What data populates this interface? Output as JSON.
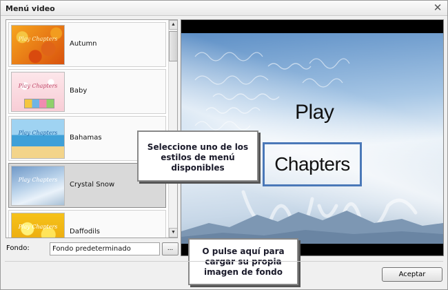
{
  "window": {
    "title": "Menú video"
  },
  "style_list": {
    "items": [
      {
        "label": "Autumn",
        "thumb_text": "Play Chapters"
      },
      {
        "label": "Baby",
        "thumb_text": "Play Chapters"
      },
      {
        "label": "Bahamas",
        "thumb_text": "Play Chapters"
      },
      {
        "label": "Crystal Snow",
        "thumb_text": "Play Chapters",
        "selected": true
      },
      {
        "label": "Daffodils",
        "thumb_text": "Play Chapters"
      }
    ]
  },
  "preview": {
    "menu_items": [
      "Play",
      "Chapters"
    ],
    "highlighted_item": "Chapters"
  },
  "callouts": {
    "style_hint": "Seleccione uno de los estilos de menú disponibles",
    "background_hint": "O pulse aquí para cargar su propia imagen de fondo"
  },
  "background": {
    "label": "Fondo:",
    "value": "Fondo predeterminado",
    "browse_label": "..."
  },
  "actions": {
    "accept_label": "Aceptar"
  },
  "colors": {
    "selection_border": "#4a78b8",
    "dialog_bg": "#f0f0f0"
  }
}
